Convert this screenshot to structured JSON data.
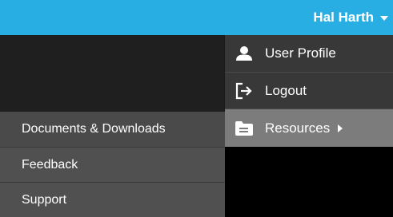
{
  "header": {
    "user_name": "Hal Harth",
    "accent_color": "#29aee4"
  },
  "user_menu": {
    "items": [
      {
        "label": "User Profile",
        "icon": "user-icon"
      },
      {
        "label": "Logout",
        "icon": "logout-icon"
      },
      {
        "label": "Resources",
        "icon": "folder-icon"
      }
    ]
  },
  "resources_submenu": {
    "items": [
      {
        "label": "Documents & Downloads"
      },
      {
        "label": "Feedback"
      },
      {
        "label": "Support"
      }
    ]
  }
}
